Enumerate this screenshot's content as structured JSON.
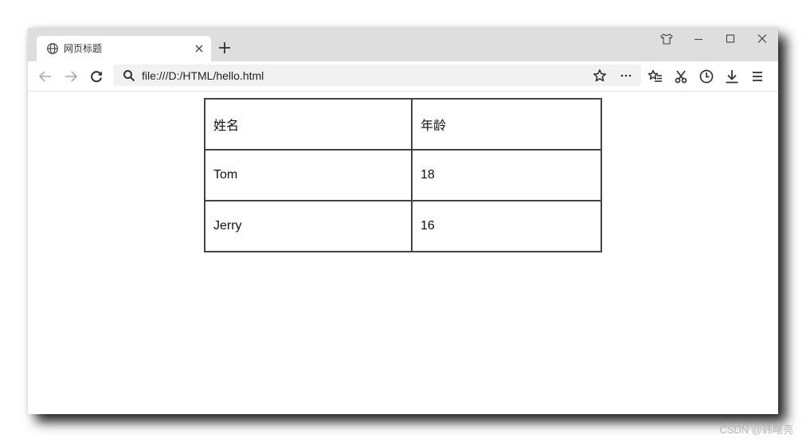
{
  "browser": {
    "tab": {
      "title": "网页标题",
      "icon": "globe-icon",
      "close_icon": "close-icon"
    },
    "new_tab_icon": "plus-icon",
    "window_controls": [
      "shirt-icon",
      "minimize-icon",
      "maximize-icon",
      "close-icon"
    ],
    "nav_buttons": [
      "back-icon",
      "forward-icon",
      "reload-icon"
    ],
    "address_bar": {
      "value": "file:///D:/HTML/hello.html",
      "icons": [
        "search-icon",
        "star-icon",
        "more-icon"
      ]
    },
    "toolbar_icons": [
      "favorites-list-icon",
      "scissors-icon",
      "history-clock-icon",
      "download-icon",
      "menu-icon"
    ]
  },
  "page": {
    "table": {
      "header": [
        "姓名",
        "年龄"
      ],
      "rows": [
        [
          "Tom",
          "18"
        ],
        [
          "Jerry",
          "16"
        ]
      ]
    }
  },
  "watermark": "CSDN @韩曙亮"
}
